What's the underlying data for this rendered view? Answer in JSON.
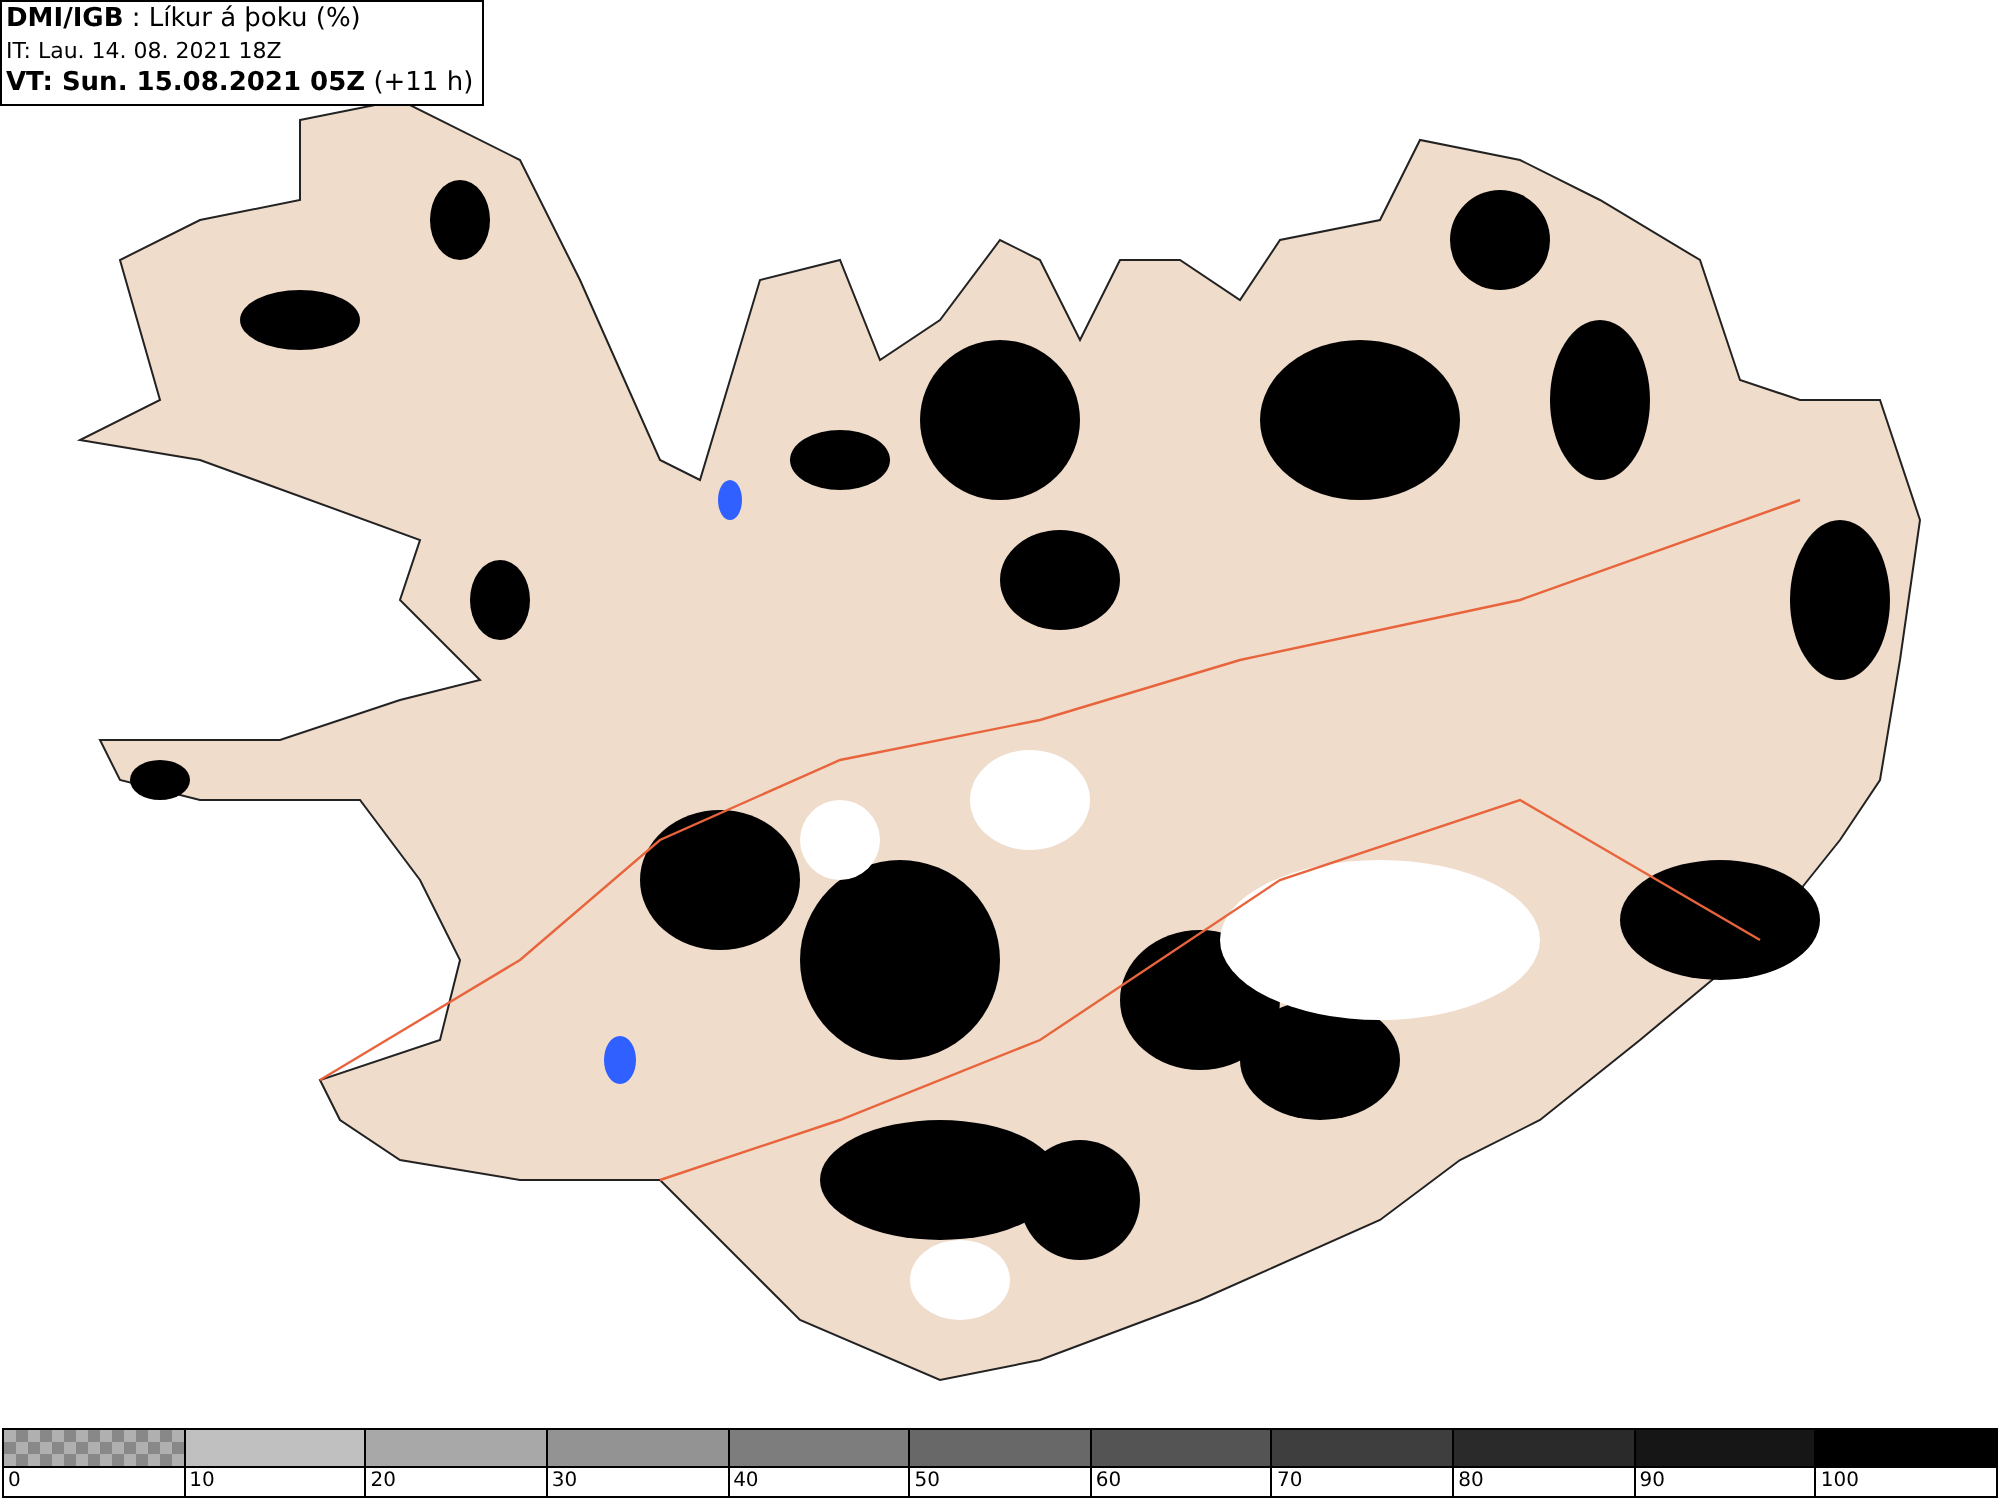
{
  "header": {
    "title": "**DMI/IGB** : Líkur á þoku (%)",
    "issue_time": "IT: Lau. 14. 08. 2021 18Z",
    "valid_time": "**VT: Sun. 15.08.2021 05Z** (+11 h)"
  },
  "legend": {
    "segments": [
      {
        "color": "#888888",
        "kind": "checker"
      },
      {
        "color": "#c0c0c0",
        "kind": "solid"
      },
      {
        "color": "#a8a8a8",
        "kind": "solid"
      },
      {
        "color": "#939393",
        "kind": "solid"
      },
      {
        "color": "#7d7d7d",
        "kind": "solid"
      },
      {
        "color": "#686868",
        "kind": "solid"
      },
      {
        "color": "#545454",
        "kind": "solid"
      },
      {
        "color": "#3e3e3e",
        "kind": "solid"
      },
      {
        "color": "#2a2a2a",
        "kind": "solid"
      },
      {
        "color": "#161616",
        "kind": "solid"
      },
      {
        "color": "#000000",
        "kind": "solid"
      }
    ],
    "labels": [
      "0",
      "10",
      "20",
      "30",
      "40",
      "50",
      "60",
      "70",
      "80",
      "90",
      "100"
    ]
  }
}
